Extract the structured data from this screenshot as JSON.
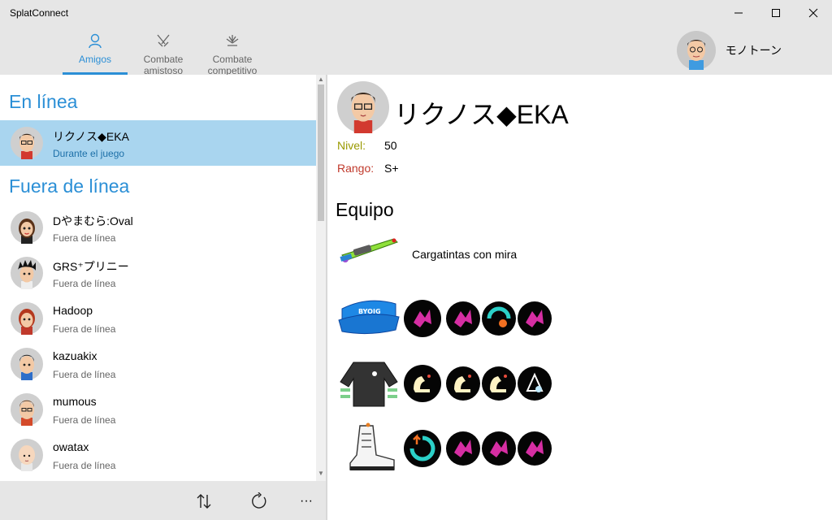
{
  "window": {
    "title": "SplatConnect",
    "controls": [
      "minimize",
      "maximize",
      "close"
    ]
  },
  "nav": {
    "tabs": [
      {
        "label": "Amigos",
        "icon": "person-icon",
        "active": true
      },
      {
        "label": "Combate amistoso",
        "icon": "crossed-weapons-icon",
        "active": false
      },
      {
        "label": "Combate competitivo",
        "icon": "trophy-icon",
        "active": false
      }
    ]
  },
  "user": {
    "name": "モノトーン"
  },
  "sections": {
    "online": "En línea",
    "offline": "Fuera de línea"
  },
  "friends_online": [
    {
      "name": "リクノス◆EKA",
      "status": "Durante el juego"
    }
  ],
  "friends_offline": [
    {
      "name": "Dやまむら:Oval",
      "status": "Fuera de línea"
    },
    {
      "name": "GRS⁺プリニー",
      "status": "Fuera de línea"
    },
    {
      "name": "Hadoop",
      "status": "Fuera de línea"
    },
    {
      "name": "kazuakix",
      "status": "Fuera de línea"
    },
    {
      "name": "mumous",
      "status": "Fuera de línea"
    },
    {
      "name": "owatax",
      "status": "Fuera de línea"
    }
  ],
  "bottom_bar": {
    "sort_icon": "sort-arrows-icon",
    "refresh_icon": "refresh-icon",
    "more_label": "···"
  },
  "detail": {
    "name": "リクノス◆EKA",
    "level_label": "Nivel:",
    "level_value": "50",
    "rank_label": "Rango:",
    "rank_value": "S+",
    "equipment_heading": "Equipo",
    "weapon": "Cargatintas con mira",
    "gear": [
      {
        "slot": "headgear",
        "icon": "visor-cap-icon",
        "main": "swim-speed-icon",
        "subs": [
          "swim-speed-icon",
          "ink-recovery-icon",
          "swim-speed-icon"
        ]
      },
      {
        "slot": "clothing",
        "icon": "striped-shirt-icon",
        "main": "run-speed-icon",
        "subs": [
          "run-speed-icon",
          "run-speed-icon",
          "bomb-range-icon"
        ]
      },
      {
        "slot": "shoes",
        "icon": "hi-top-sneaker-icon",
        "main": "special-charge-icon",
        "subs": [
          "swim-speed-icon",
          "swim-speed-icon",
          "swim-speed-icon"
        ]
      }
    ]
  },
  "colors": {
    "accent": "#2b8fd6",
    "selected_row": "#a9d5ef",
    "level_label": "#9a9a00",
    "rank_label": "#c0392b",
    "ability_magenta": "#d62ea3"
  }
}
